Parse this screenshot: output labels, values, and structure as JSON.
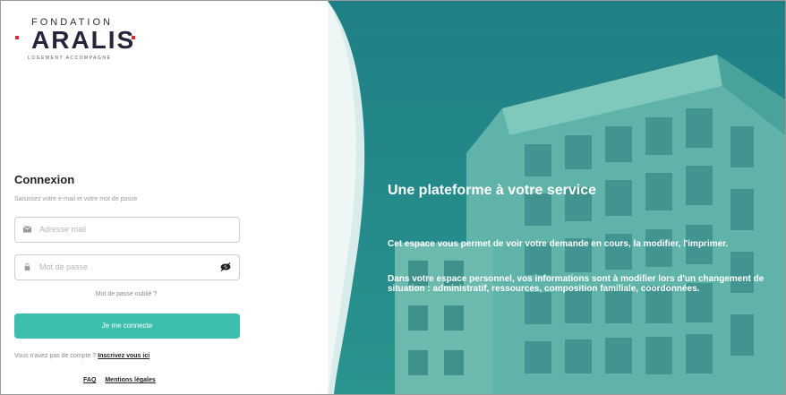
{
  "logo": {
    "top_text": "FONDATION",
    "brand": "ARALIS",
    "tagline": "LOGEMENT ACCOMPAGNÉ"
  },
  "login": {
    "title": "Connexion",
    "subtitle": "Saisissez votre e-mail et votre mot de passe",
    "email_placeholder": "Adresse mail",
    "password_placeholder": "Mot de passe",
    "forgot_link": "Mot de passe oublié ?",
    "submit_label": "Je me connecte",
    "no_account_text": "Vous n'avez pas de compte ?",
    "signup_link": "Inscrivez vous ici"
  },
  "footer": {
    "faq": "FAQ",
    "legal": "Mentions légales"
  },
  "hero": {
    "title": "Une plateforme à votre service",
    "paragraph1": "Cet espace vous permet de voir votre demande en cours, la modifier, l'imprimer.",
    "paragraph2": "Dans votre espace personnel, vos informations sont à modifier lors d'un changement de situation : administratif, ressources, composition familiale, coordonnées."
  },
  "colors": {
    "accent": "#3dbfae",
    "hero_overlay": "#2a8f8a",
    "logo_red": "#e0262f"
  },
  "icons": {
    "email": "envelope-icon",
    "password": "lock-icon",
    "visibility": "eye-slash-icon"
  }
}
